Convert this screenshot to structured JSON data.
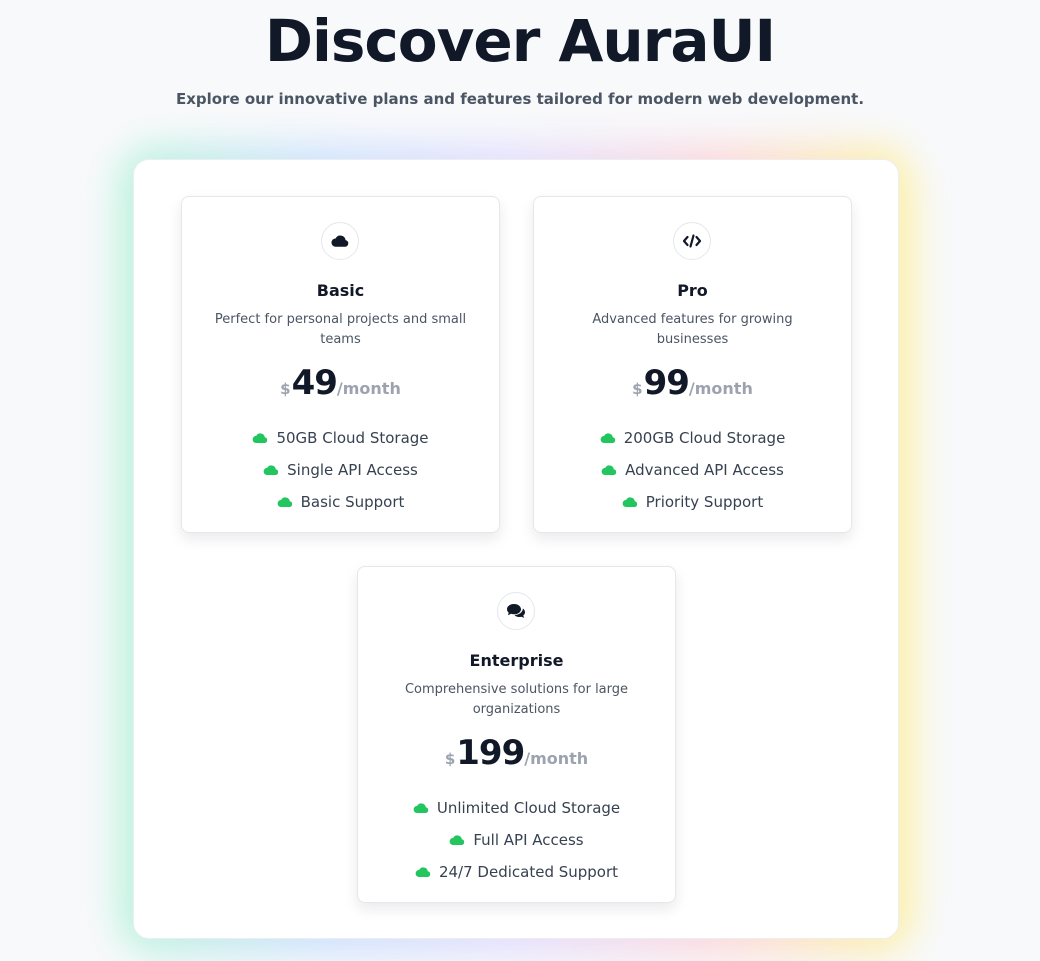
{
  "header": {
    "title": "Discover AuraUI",
    "subtitle": "Explore our innovative plans and features tailored for modern web development."
  },
  "colors": {
    "accent_green": "#22c55e",
    "text_dark": "#111827",
    "text_muted": "#9ca3af"
  },
  "plans": [
    {
      "name": "Basic",
      "icon": "cloud-icon",
      "description": "Perfect for personal projects and small teams",
      "currency": "$",
      "price": "49",
      "period": "/month",
      "features": [
        "50GB Cloud Storage",
        "Single API Access",
        "Basic Support"
      ]
    },
    {
      "name": "Pro",
      "icon": "code-icon",
      "description": "Advanced features for growing businesses",
      "currency": "$",
      "price": "99",
      "period": "/month",
      "features": [
        "200GB Cloud Storage",
        "Advanced API Access",
        "Priority Support"
      ]
    },
    {
      "name": "Enterprise",
      "icon": "comments-icon",
      "description": "Comprehensive solutions for large organizations",
      "currency": "$",
      "price": "199",
      "period": "/month",
      "features": [
        "Unlimited Cloud Storage",
        "Full API Access",
        "24/7 Dedicated Support"
      ]
    }
  ]
}
